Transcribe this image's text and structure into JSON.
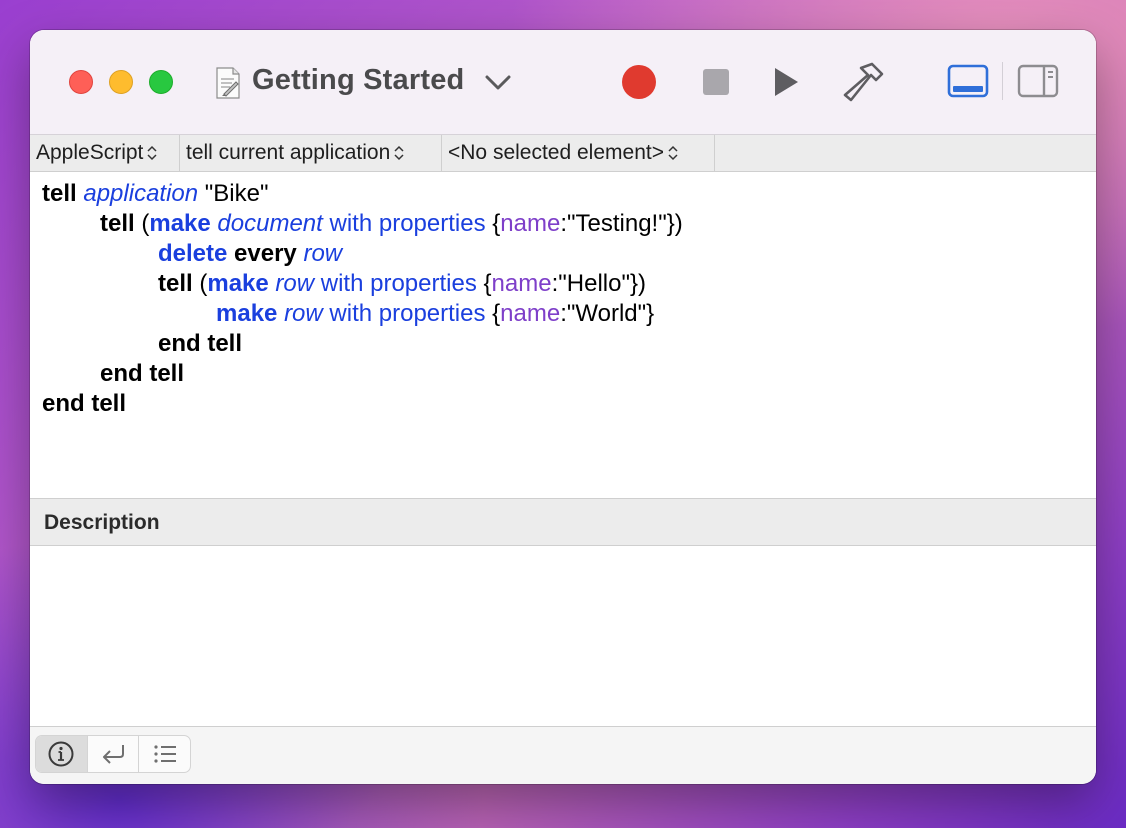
{
  "window": {
    "title": "Getting Started"
  },
  "toolbar": {
    "record": "record-icon",
    "stop": "stop-icon",
    "run": "run-icon",
    "compile": "hammer-icon",
    "view_bottom": "bottom-panel-icon",
    "view_side": "side-panel-icon",
    "colors": {
      "record": "#e03a2f",
      "active_view": "#2f6fd9"
    }
  },
  "navigation": {
    "language": "AppleScript",
    "target": "tell current application",
    "element": "<No selected element>"
  },
  "script": {
    "lines": [
      [
        "tell",
        " ",
        "application",
        " \"Bike\""
      ],
      [
        "tell",
        " (",
        "make",
        " ",
        "document",
        " ",
        "with properties",
        " {",
        "name",
        ":\"Testing!\"})"
      ],
      [
        "delete",
        " ",
        "every",
        " ",
        "row"
      ],
      [
        "tell",
        " (",
        "make",
        " ",
        "row",
        " ",
        "with properties",
        " {",
        "name",
        ":\"Hello\"})"
      ],
      [
        "make",
        " ",
        "row",
        " ",
        "with properties",
        " {",
        "name",
        ":\"World\"}"
      ],
      [
        "end tell"
      ],
      [
        "end tell"
      ],
      [
        "end tell"
      ]
    ]
  },
  "description": {
    "title": "Description",
    "body": ""
  },
  "bottombar": {
    "buttons": [
      "info-icon",
      "return-icon",
      "list-icon"
    ],
    "active": "info-icon"
  }
}
